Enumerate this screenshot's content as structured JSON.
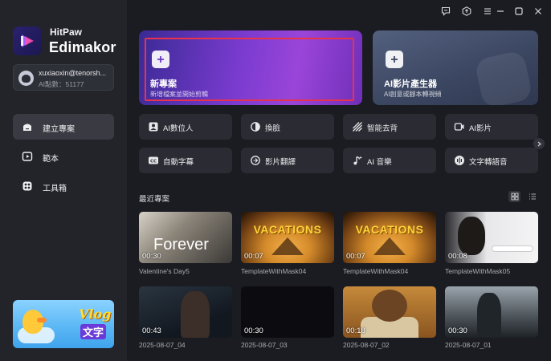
{
  "app": {
    "brand_small": "HitPaw",
    "brand_big": "Edimakor"
  },
  "user": {
    "email": "xuxiaoxin@tenorsh...",
    "points": "AI點數：51177"
  },
  "sidebar": {
    "items": [
      {
        "label": "建立專案",
        "icon": "home-icon",
        "active": true
      },
      {
        "label": "範本",
        "icon": "template-icon",
        "active": false
      },
      {
        "label": "工具箱",
        "icon": "toolbox-icon",
        "active": false
      }
    ]
  },
  "promo": {
    "title": "Vlog",
    "subtitle": "文字"
  },
  "hero": {
    "new_project": {
      "title": "新專案",
      "subtitle": "新增檔案並開始剪輯"
    },
    "ai_generator": {
      "title": "AI影片產生器",
      "subtitle": "AI創意或腳本轉視頻"
    }
  },
  "features": [
    {
      "label": "AI數位人",
      "icon": "avatar-person-icon"
    },
    {
      "label": "換臉",
      "icon": "face-swap-icon"
    },
    {
      "label": "智能去背",
      "icon": "background-remove-icon"
    },
    {
      "label": "AI影片",
      "icon": "ai-video-icon"
    },
    {
      "label": "自動字幕",
      "icon": "caption-icon"
    },
    {
      "label": "影片翻譯",
      "icon": "translate-icon"
    },
    {
      "label": "AI 音樂",
      "icon": "music-note-icon"
    },
    {
      "label": "文字轉語音",
      "icon": "text-to-speech-icon"
    }
  ],
  "recent": {
    "title": "最近專案",
    "projects": [
      {
        "name": "Valentine's Day5",
        "duration": "00:30",
        "overlay": "Forever"
      },
      {
        "name": "TemplateWithMask04",
        "duration": "00:07",
        "overlay": "VACATIONS"
      },
      {
        "name": "TemplateWithMask04",
        "duration": "00:07",
        "overlay": "VACATIONS"
      },
      {
        "name": "TemplateWithMask05",
        "duration": "00:08",
        "overlay": ""
      },
      {
        "name": "2025-08-07_04",
        "duration": "00:43",
        "overlay": ""
      },
      {
        "name": "2025-08-07_03",
        "duration": "00:30",
        "overlay": ""
      },
      {
        "name": "2025-08-07_02",
        "duration": "00:18",
        "overlay": ""
      },
      {
        "name": "2025-08-07_01",
        "duration": "00:30",
        "overlay": ""
      }
    ]
  },
  "colors": {
    "background": "#1b1c21",
    "sidebar": "#23242a",
    "accent_purple": "#7a3bcf",
    "selection_red": "#e8334a"
  }
}
